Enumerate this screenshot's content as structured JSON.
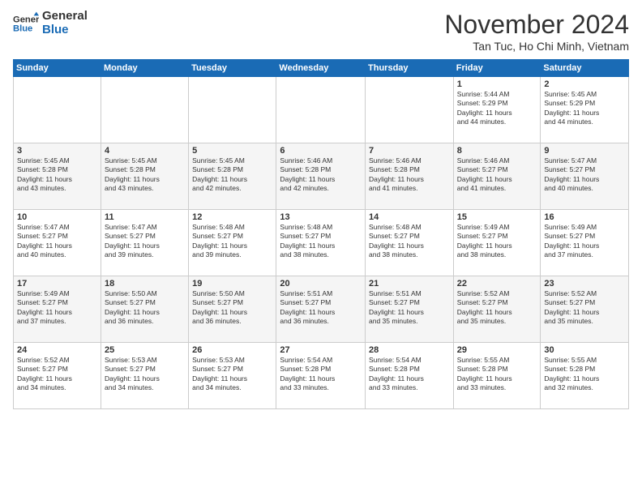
{
  "logo": {
    "line1": "General",
    "line2": "Blue"
  },
  "title": "November 2024",
  "subtitle": "Tan Tuc, Ho Chi Minh, Vietnam",
  "days_of_week": [
    "Sunday",
    "Monday",
    "Tuesday",
    "Wednesday",
    "Thursday",
    "Friday",
    "Saturday"
  ],
  "weeks": [
    [
      {
        "day": "",
        "detail": ""
      },
      {
        "day": "",
        "detail": ""
      },
      {
        "day": "",
        "detail": ""
      },
      {
        "day": "",
        "detail": ""
      },
      {
        "day": "",
        "detail": ""
      },
      {
        "day": "1",
        "detail": "Sunrise: 5:44 AM\nSunset: 5:29 PM\nDaylight: 11 hours\nand 44 minutes."
      },
      {
        "day": "2",
        "detail": "Sunrise: 5:45 AM\nSunset: 5:29 PM\nDaylight: 11 hours\nand 44 minutes."
      }
    ],
    [
      {
        "day": "3",
        "detail": "Sunrise: 5:45 AM\nSunset: 5:28 PM\nDaylight: 11 hours\nand 43 minutes."
      },
      {
        "day": "4",
        "detail": "Sunrise: 5:45 AM\nSunset: 5:28 PM\nDaylight: 11 hours\nand 43 minutes."
      },
      {
        "day": "5",
        "detail": "Sunrise: 5:45 AM\nSunset: 5:28 PM\nDaylight: 11 hours\nand 42 minutes."
      },
      {
        "day": "6",
        "detail": "Sunrise: 5:46 AM\nSunset: 5:28 PM\nDaylight: 11 hours\nand 42 minutes."
      },
      {
        "day": "7",
        "detail": "Sunrise: 5:46 AM\nSunset: 5:28 PM\nDaylight: 11 hours\nand 41 minutes."
      },
      {
        "day": "8",
        "detail": "Sunrise: 5:46 AM\nSunset: 5:27 PM\nDaylight: 11 hours\nand 41 minutes."
      },
      {
        "day": "9",
        "detail": "Sunrise: 5:47 AM\nSunset: 5:27 PM\nDaylight: 11 hours\nand 40 minutes."
      }
    ],
    [
      {
        "day": "10",
        "detail": "Sunrise: 5:47 AM\nSunset: 5:27 PM\nDaylight: 11 hours\nand 40 minutes."
      },
      {
        "day": "11",
        "detail": "Sunrise: 5:47 AM\nSunset: 5:27 PM\nDaylight: 11 hours\nand 39 minutes."
      },
      {
        "day": "12",
        "detail": "Sunrise: 5:48 AM\nSunset: 5:27 PM\nDaylight: 11 hours\nand 39 minutes."
      },
      {
        "day": "13",
        "detail": "Sunrise: 5:48 AM\nSunset: 5:27 PM\nDaylight: 11 hours\nand 38 minutes."
      },
      {
        "day": "14",
        "detail": "Sunrise: 5:48 AM\nSunset: 5:27 PM\nDaylight: 11 hours\nand 38 minutes."
      },
      {
        "day": "15",
        "detail": "Sunrise: 5:49 AM\nSunset: 5:27 PM\nDaylight: 11 hours\nand 38 minutes."
      },
      {
        "day": "16",
        "detail": "Sunrise: 5:49 AM\nSunset: 5:27 PM\nDaylight: 11 hours\nand 37 minutes."
      }
    ],
    [
      {
        "day": "17",
        "detail": "Sunrise: 5:49 AM\nSunset: 5:27 PM\nDaylight: 11 hours\nand 37 minutes."
      },
      {
        "day": "18",
        "detail": "Sunrise: 5:50 AM\nSunset: 5:27 PM\nDaylight: 11 hours\nand 36 minutes."
      },
      {
        "day": "19",
        "detail": "Sunrise: 5:50 AM\nSunset: 5:27 PM\nDaylight: 11 hours\nand 36 minutes."
      },
      {
        "day": "20",
        "detail": "Sunrise: 5:51 AM\nSunset: 5:27 PM\nDaylight: 11 hours\nand 36 minutes."
      },
      {
        "day": "21",
        "detail": "Sunrise: 5:51 AM\nSunset: 5:27 PM\nDaylight: 11 hours\nand 35 minutes."
      },
      {
        "day": "22",
        "detail": "Sunrise: 5:52 AM\nSunset: 5:27 PM\nDaylight: 11 hours\nand 35 minutes."
      },
      {
        "day": "23",
        "detail": "Sunrise: 5:52 AM\nSunset: 5:27 PM\nDaylight: 11 hours\nand 35 minutes."
      }
    ],
    [
      {
        "day": "24",
        "detail": "Sunrise: 5:52 AM\nSunset: 5:27 PM\nDaylight: 11 hours\nand 34 minutes."
      },
      {
        "day": "25",
        "detail": "Sunrise: 5:53 AM\nSunset: 5:27 PM\nDaylight: 11 hours\nand 34 minutes."
      },
      {
        "day": "26",
        "detail": "Sunrise: 5:53 AM\nSunset: 5:27 PM\nDaylight: 11 hours\nand 34 minutes."
      },
      {
        "day": "27",
        "detail": "Sunrise: 5:54 AM\nSunset: 5:28 PM\nDaylight: 11 hours\nand 33 minutes."
      },
      {
        "day": "28",
        "detail": "Sunrise: 5:54 AM\nSunset: 5:28 PM\nDaylight: 11 hours\nand 33 minutes."
      },
      {
        "day": "29",
        "detail": "Sunrise: 5:55 AM\nSunset: 5:28 PM\nDaylight: 11 hours\nand 33 minutes."
      },
      {
        "day": "30",
        "detail": "Sunrise: 5:55 AM\nSunset: 5:28 PM\nDaylight: 11 hours\nand 32 minutes."
      }
    ]
  ]
}
